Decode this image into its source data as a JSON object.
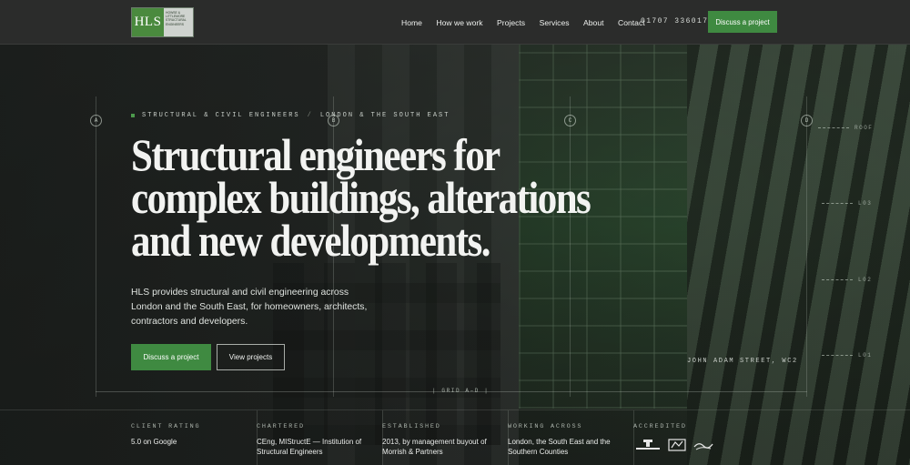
{
  "brand": {
    "logo_mark": "HLS",
    "logo_lines": [
      "Howse &",
      "Littlemore",
      "Structural",
      "Engineers"
    ]
  },
  "nav": {
    "links": [
      "Home",
      "How we work",
      "Projects",
      "Services",
      "About",
      "Contact"
    ],
    "phone": "01707 336017",
    "cta": "Discuss a project"
  },
  "hero": {
    "eyebrow_left": "STRUCTURAL & CIVIL ENGINEERS",
    "eyebrow_sep": "/",
    "eyebrow_right": "LONDON & THE SOUTH EAST",
    "headline_lines": [
      "Structural engineers for",
      "complex buildings, alterations",
      "and new developments."
    ],
    "lede": "HLS provides structural and civil engineering across London and the South East, for homeowners, architects, contractors and developers.",
    "primary_button": "Discuss a project",
    "secondary_button": "View projects",
    "location": "JOHN ADAM STREET, WC2",
    "grid_markers": [
      "A",
      "B",
      "C",
      "D"
    ],
    "levels": [
      "ROOF",
      "L03",
      "L02",
      "L01"
    ],
    "grid_label": "| GRID A–D |"
  },
  "stats": [
    {
      "label": "CLIENT RATING",
      "value": "5.0 on Google"
    },
    {
      "label": "CHARTERED",
      "value": "CEng, MIStructE — Institution of Structural Engineers"
    },
    {
      "label": "ESTABLISHED",
      "value": "2013, by management buyout of Morrish & Partners"
    },
    {
      "label": "WORKING ACROSS",
      "value": "London, the South East and the Southern Counties"
    },
    {
      "label": "ACCREDITED",
      "value": ""
    }
  ],
  "accreditations": [
    "constructionline-logo",
    "association-logo",
    "chas-logo"
  ],
  "colors": {
    "accent_green": "#3f8a41",
    "nav_bg": "#2b2c2b",
    "hero_bg": "#1c1f1d"
  }
}
